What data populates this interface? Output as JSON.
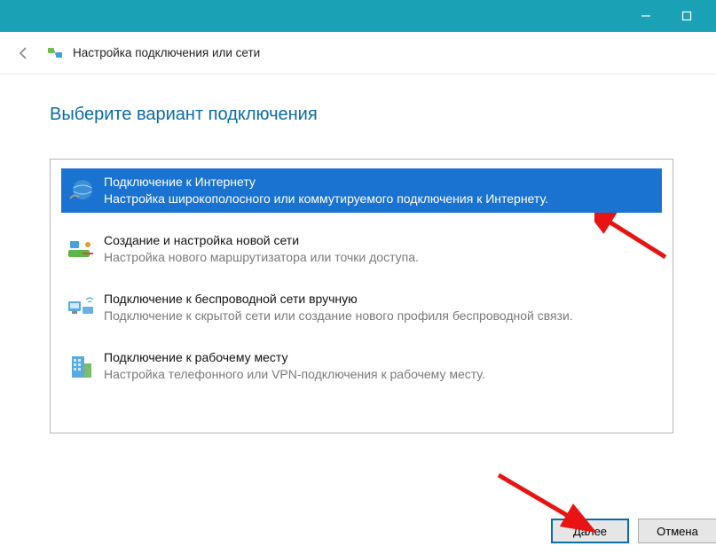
{
  "window": {
    "title": "Настройка подключения или сети"
  },
  "page": {
    "heading": "Выберите вариант подключения"
  },
  "options": [
    {
      "title": "Подключение к Интернету",
      "desc": "Настройка широкополосного или коммутируемого подключения к Интернету."
    },
    {
      "title": "Создание и настройка новой сети",
      "desc": "Настройка нового маршрутизатора или точки доступа."
    },
    {
      "title": "Подключение к беспроводной сети вручную",
      "desc": "Подключение к скрытой сети или создание нового профиля беспроводной связи."
    },
    {
      "title": "Подключение к рабочему месту",
      "desc": "Настройка телефонного или VPN-подключения к рабочему месту."
    }
  ],
  "buttons": {
    "next": "Далее",
    "cancel": "Отмена"
  }
}
